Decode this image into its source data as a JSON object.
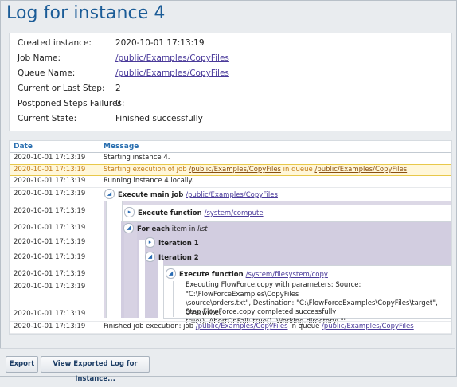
{
  "title": "Log for instance 4",
  "info": {
    "rows": [
      {
        "label": "Created instance:",
        "value": "2020-10-01 17:13:19"
      },
      {
        "label": "Job Name:",
        "value": "/public/Examples/CopyFiles"
      },
      {
        "label": "Queue Name:",
        "value": "/public/Examples/CopyFiles"
      },
      {
        "label": "Current or Last Step:",
        "value": "2"
      },
      {
        "label": "Postponed Steps Failures:",
        "value": "0"
      },
      {
        "label": "Current State:",
        "value": "Finished successfully"
      }
    ]
  },
  "log": {
    "headers": {
      "date": "Date",
      "message": "Message"
    },
    "rows": [
      {
        "date": "2020-10-01 17:13:19",
        "message": "Starting instance 4."
      },
      {
        "date": "2020-10-01 17:13:19",
        "pre": "Starting execution of job ",
        "job": "/public/Examples/CopyFiles",
        "mid": " in queue ",
        "queue": "/public/Examples/CopyFiles"
      },
      {
        "date": "2020-10-01 17:13:19",
        "message": "Running instance 4 locally."
      },
      {
        "date": "2020-10-01 17:13:19",
        "label": "Execute main job ",
        "link": "/public/Examples/CopyFiles"
      },
      {
        "date": "2020-10-01 17:13:19",
        "label": "Execute function ",
        "link": "/system/compute"
      },
      {
        "date": "2020-10-01 17:13:19",
        "label": "For each",
        "mid": " item in ",
        "italic": "list"
      },
      {
        "date": "2020-10-01 17:13:19",
        "label": "Iteration 1"
      },
      {
        "date": "2020-10-01 17:13:19",
        "label": "Iteration 2"
      },
      {
        "date": "2020-10-01 17:13:19",
        "label": "Execute function ",
        "link": "/system/filesystem/copy"
      },
      {
        "date": "2020-10-01 17:13:19",
        "lines": [
          "Executing FlowForce.copy with parameters: Source: \"C:\\FlowForceExamples\\CopyFiles",
          "\\source\\orders.txt\", Destination: \"C:\\FlowForceExamples\\CopyFiles\\target\", Overwrite:",
          "true(), AbortOnFail: true(), Working-directory: \"\""
        ]
      },
      {
        "date": "2020-10-01 17:13:19",
        "message": "Step FlowForce.copy completed successfully"
      },
      {
        "date": "2020-10-01 17:13:19",
        "pre": "Finished job execution: job ",
        "job": "/public/Examples/CopyFiles",
        "mid": " in queue ",
        "queue": "/public/Examples/CopyFiles"
      }
    ]
  },
  "buttons": {
    "export": "Export",
    "view_exported": "View Exported Log for Instance..."
  }
}
